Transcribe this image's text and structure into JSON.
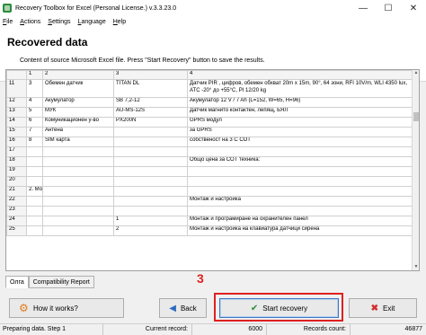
{
  "window": {
    "title": "Recovery Toolbox for Excel (Personal License.) v.3.3.23.0",
    "minimize": "—",
    "maximize": "☐",
    "close": "✕"
  },
  "menu": {
    "items": [
      {
        "first": "F",
        "rest": "ile"
      },
      {
        "first": "A",
        "rest": "ctions"
      },
      {
        "first": "S",
        "rest": "ettings"
      },
      {
        "first": "L",
        "rest": "anguage"
      },
      {
        "first": "H",
        "rest": "elp"
      }
    ]
  },
  "header": {
    "title": "Recovered data",
    "subtitle": "Content of source Microsoft Excel file. Press \"Start Recovery\" button to save the results."
  },
  "grid": {
    "columns": [
      "",
      "1",
      "2",
      "3",
      "4"
    ],
    "rows": [
      {
        "n": "11",
        "c1": "3",
        "c2": "Обемен датчик",
        "c3": "TITAN DL",
        "c4": "Датчик PIR , цифров, обемен обхват 20m x 15m, 90°, 64 зони, RFI 10V/m, WLI 4350 lux, ATC -20° до +55°C, PI 12/20 kg",
        "tall": true
      },
      {
        "n": "12",
        "c1": "4",
        "c2": "Акумулатор",
        "c3": "SB 7,2-12",
        "c4": "Акумулатор 12 V / 7 Ah (L=152, W=65, H=96)"
      },
      {
        "n": "13",
        "c1": "5",
        "c2": "МУК",
        "c3": "AU-MS-12S",
        "c4": "Датчик магнито контактен, лепящ, БЯЛ"
      },
      {
        "n": "14",
        "c1": "6",
        "c2": "Комуникационен у-во",
        "c3": "PX200N",
        "c4": "GPRS модул"
      },
      {
        "n": "15",
        "c1": "7",
        "c2": "Антена",
        "c3": "",
        "c4": "за GPRS"
      },
      {
        "n": "16",
        "c1": "8",
        "c2": "SIM карта",
        "c3": "",
        "c4": "собственост на 3 С СОТ"
      },
      {
        "n": "17",
        "c1": "",
        "c2": "",
        "c3": "",
        "c4": ""
      },
      {
        "n": "18",
        "c1": "",
        "c2": "",
        "c3": "",
        "c4": "Общо цена за СОТ техника:"
      },
      {
        "n": "19",
        "c1": "",
        "c2": "",
        "c3": "",
        "c4": ""
      },
      {
        "n": "20",
        "c1": "",
        "c2": "",
        "c3": "",
        "c4": ""
      },
      {
        "n": "21",
        "c1": "2. Мо",
        "c2": "",
        "c3": "",
        "c4": ""
      },
      {
        "n": "22",
        "c1": "",
        "c2": "",
        "c3": "",
        "c4": "Монтаж и настройка"
      },
      {
        "n": "23",
        "c1": "",
        "c2": "",
        "c3": "",
        "c4": ""
      },
      {
        "n": "24",
        "c1": "",
        "c2": "",
        "c3": "1",
        "c4": "Монтаж и програмиране на охранителен панел"
      },
      {
        "n": "25",
        "c1": "",
        "c2": "",
        "c3": "2",
        "c4": "Монтаж и настройка на клавиатура датчици сирена"
      }
    ]
  },
  "sheet_tabs": [
    "Олга",
    "Compatibility Report"
  ],
  "step_number": "3",
  "buttons": {
    "how_it_works": "How it works?",
    "back": "Back",
    "start_recovery": "Start recovery",
    "exit": "Exit"
  },
  "icons": {
    "how_it_works": "gears-icon",
    "back": "back-arrow-icon",
    "start": "checkmark-icon",
    "exit": "x-icon"
  },
  "status": {
    "message": "Preparing data. Step 1",
    "current_record_label": "Current record:",
    "current_record_value": "6000",
    "records_count_label": "Records count:",
    "records_count_value": "46877"
  },
  "colors": {
    "highlight": "#e02020",
    "start_border": "#3b77c4",
    "check_green": "#2d8c3c"
  }
}
